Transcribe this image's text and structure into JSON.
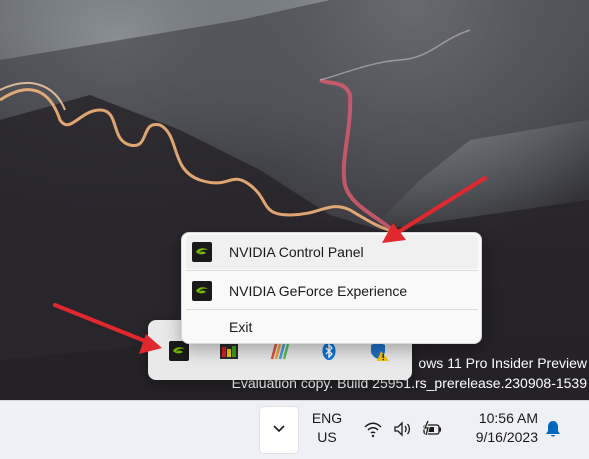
{
  "watermark": {
    "line1": "ows 11 Pro Insider Preview",
    "line2": "Evaluation copy. Build 25951.rs_prerelease.230908-1539"
  },
  "tray_flyout": {
    "icons": [
      "nvidia-icon",
      "performance-meter-icon",
      "color-bars-icon",
      "bluetooth-icon",
      "windows-security-warning-icon"
    ]
  },
  "context_menu": {
    "items": [
      {
        "label": "NVIDIA Control Panel",
        "icon": "nvidia-icon"
      },
      {
        "label": "NVIDIA GeForce Experience",
        "icon": "nvidia-icon"
      },
      {
        "label": "Exit",
        "icon": ""
      }
    ]
  },
  "taskbar": {
    "language": {
      "line1": "ENG",
      "line2": "US"
    },
    "clock": {
      "time": "10:56 AM",
      "date": "9/16/2023"
    },
    "icons": [
      "chevron-up-icon",
      "wifi-icon",
      "speaker-icon",
      "battery-charging-icon",
      "notification-bell-icon"
    ]
  },
  "colors": {
    "annotation_arrow": "#e0282e",
    "nvidia_green": "#76b900",
    "taskbar_bg": "#eef0f5",
    "accent": "#0067c0"
  }
}
